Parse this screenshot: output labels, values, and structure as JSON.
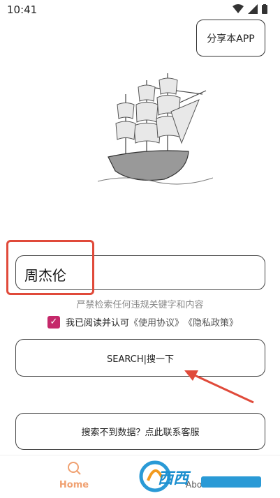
{
  "status": {
    "time": "10:41"
  },
  "header": {
    "share_label": "分享本APP"
  },
  "search": {
    "value": "周杰伦"
  },
  "warning_text": "严禁检索任何违规关键字和内容",
  "agreement": {
    "prefix": "我已阅读并认可",
    "terms": "《使用协议》",
    "privacy": "《隐私政策》"
  },
  "buttons": {
    "search_label": "SEARCH|搜一下",
    "contact_label": "搜索不到数据？点此联系客服"
  },
  "tabs": [
    {
      "label": "Home",
      "icon": "search-icon"
    },
    {
      "label": "About",
      "icon": "info-icon"
    }
  ],
  "watermark": {
    "text": "西西",
    "site": "软件园",
    "url": "CR173.COM"
  },
  "colors": {
    "accent": "#c5286a",
    "tab_active": "#f0a070",
    "annotation": "#e04a3a"
  }
}
